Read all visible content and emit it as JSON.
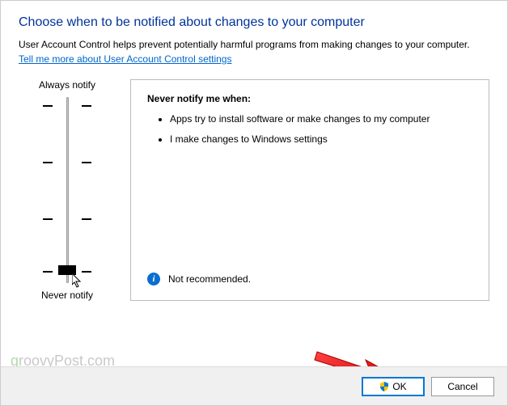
{
  "heading": "Choose when to be notified about changes to your computer",
  "description": "User Account Control helps prevent potentially harmful programs from making changes to your computer.",
  "link_text": "Tell me more about User Account Control settings",
  "slider": {
    "top_label": "Always notify",
    "bottom_label": "Never notify"
  },
  "panel": {
    "title": "Never notify me when:",
    "bullets": [
      "Apps try to install software or make changes to my computer",
      "I make changes to Windows settings"
    ],
    "recommendation": "Not recommended."
  },
  "buttons": {
    "ok": "OK",
    "cancel": "Cancel"
  },
  "watermark": "groovyPost.com"
}
